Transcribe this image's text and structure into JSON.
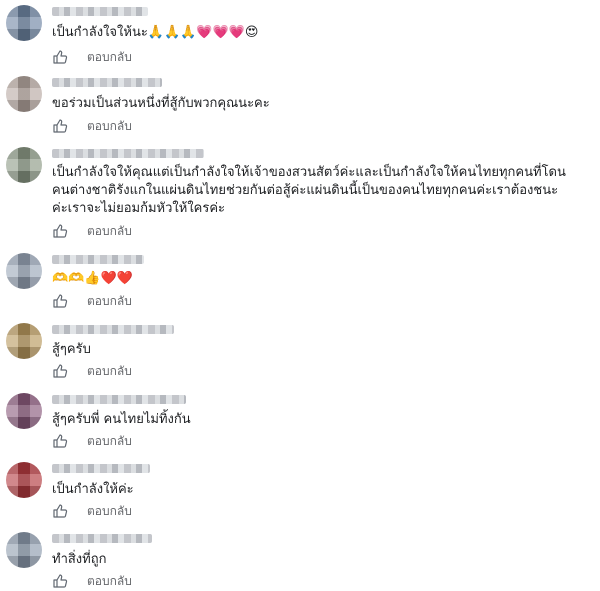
{
  "comments": [
    {
      "text": "เป็นกำลังใจให้นะ🙏🙏🙏💗💗💗😍",
      "reply_label": "ตอบกลับ",
      "avatar_color": "#6f86a4"
    },
    {
      "text": "ขอร่วมเป็นส่วนหนึ่งที่สู้กับพวกคุณนะคะ",
      "reply_label": "ตอบกลับ",
      "avatar_color": "#b8a9a2"
    },
    {
      "text": "เป็นกำลังใจให้คุณแต่เป็นกำลังใจให้เจ้าของสวนสัตว์ค่ะและเป็นกำลังใจให้คนไทยทุกคนที่โดนคนต่างชาติรังแกในแผ่นดินไทยช่วยกันต่อสู้ค่ะแผ่นดินนี้เป็นของคนไทยทุกคนค่ะเราต้องชนะค่ะเราจะไม่ยอมก้มหัวให้ใครค่ะ",
      "reply_label": "ตอบกลับ",
      "avatar_color": "#8c9a86"
    },
    {
      "text": "🫶🫶👍❤️❤️",
      "reply_label": "ตอบกลับ",
      "avatar_color": "#9aa6b8"
    },
    {
      "text": "สู้ๆครับ",
      "reply_label": "ตอบกลับ",
      "avatar_color": "#b8985e"
    },
    {
      "text": "สู้ๆครับพี่ คนไทยไม่ทิ้งกัน",
      "reply_label": "ตอบกลับ",
      "avatar_color": "#8a5a7c"
    },
    {
      "text": "เป็นกำลังให้ค่ะ",
      "reply_label": "ตอบกลับ",
      "avatar_color": "#b33a3f"
    },
    {
      "text": "ทำสิ่งที่ถูก",
      "reply_label": "ตอบกลับ",
      "avatar_color": "#8e9cae"
    }
  ]
}
